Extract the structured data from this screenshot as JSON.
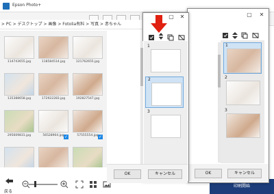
{
  "main_window": {
    "title": "Epson Photo+",
    "breadcrumb": [
      "PC",
      "デスクトップ",
      "画像",
      "Fotolia有料",
      "写真",
      "赤ちゃん"
    ],
    "thumbnails": [
      {
        "file": "114743655.jpg",
        "checked": false,
        "tone": "p-white"
      },
      {
        "file": "118584514.jpg",
        "checked": false,
        "tone": "p-baby"
      },
      {
        "file": "121762655.jpg",
        "checked": false,
        "tone": "p-white"
      },
      {
        "file": "135388658.jpg",
        "checked": false,
        "tone": "p-blue"
      },
      {
        "file": "172922283.jpg",
        "checked": false,
        "tone": "p-baby"
      },
      {
        "file": "192827547.jpg",
        "checked": false,
        "tone": "p-child"
      },
      {
        "file": "295609831.jpg",
        "checked": false,
        "tone": "p-green"
      },
      {
        "file": "56528904.jpg",
        "checked": true,
        "tone": "p-white"
      },
      {
        "file": "57555554.jpg",
        "checked": true,
        "tone": "p-child"
      },
      {
        "file": "",
        "checked": true,
        "tone": "p-blue"
      },
      {
        "file": "",
        "checked": false,
        "tone": "p-baby"
      },
      {
        "file": "",
        "checked": false,
        "tone": "p-green"
      }
    ],
    "back_label": "戻る",
    "print_start_label": "印刷開始"
  },
  "front_dialog": {
    "pages": [
      {
        "num": "1",
        "selected": false,
        "tone": "p-white"
      },
      {
        "num": "2",
        "selected": true,
        "tone": "p-baby"
      },
      {
        "num": "3",
        "selected": false,
        "tone": "p-white"
      }
    ],
    "ok_label": "OK",
    "cancel_label": "キャンセル"
  },
  "second_dialog": {
    "pages": [
      {
        "num": "1",
        "selected": true,
        "tone": "p-baby"
      },
      {
        "num": "2",
        "selected": false,
        "tone": "p-white"
      },
      {
        "num": "3",
        "selected": false,
        "tone": "p-child"
      }
    ],
    "ok_label": "OK",
    "cancel_label": "キャンセル"
  },
  "colors": {
    "accent_blue": "#1c3d7a",
    "selection": "#cfe3f5",
    "arrow_red": "#e02010",
    "check_blue": "#1e88e5"
  }
}
